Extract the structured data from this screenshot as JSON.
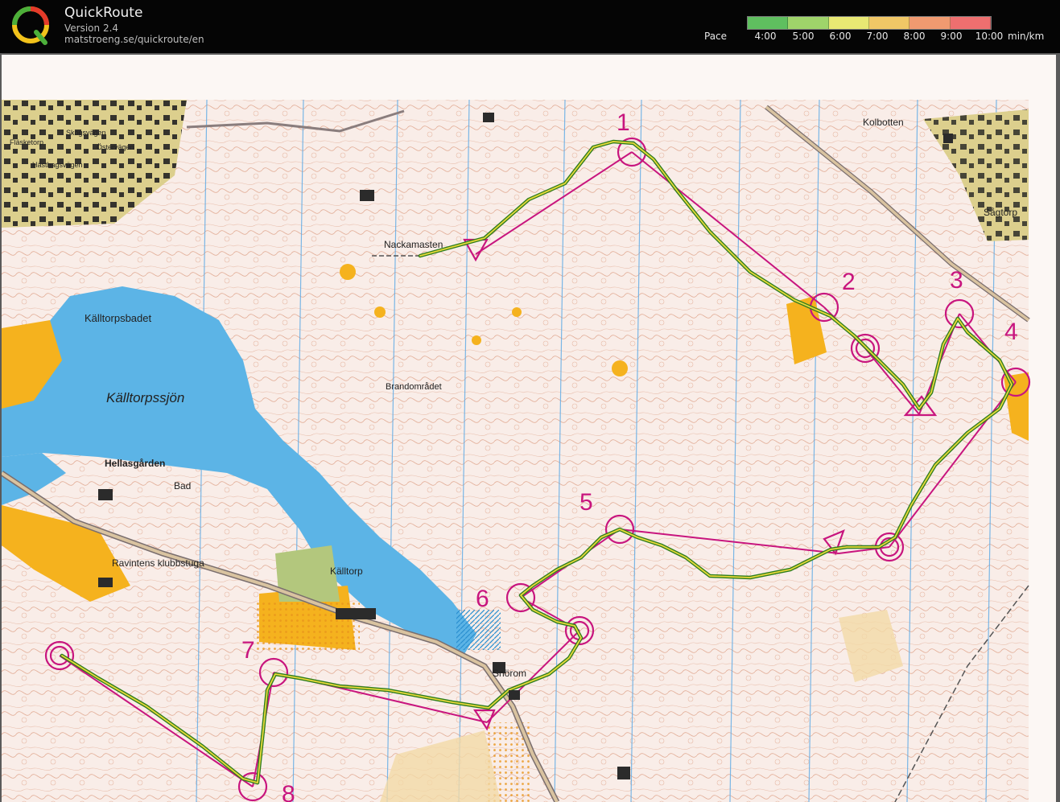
{
  "app": {
    "title": "QuickRoute",
    "version": "Version 2.4",
    "url": "matstroeng.se/quickroute/en",
    "logo_letter": "Q"
  },
  "pace_legend": {
    "label": "Pace",
    "ticks": [
      "4:00",
      "5:00",
      "6:00",
      "7:00",
      "8:00",
      "9:00",
      "10:00"
    ],
    "unit": "min/km",
    "colors": [
      "#5fbf5f",
      "#9fd46a",
      "#e8e873",
      "#f0c766",
      "#f09a70",
      "#ee6f6f"
    ]
  },
  "map": {
    "colors": {
      "course": "#c8157e",
      "water": "#5cb4e6",
      "contour": "#c8663e",
      "open_land": "#f5b21e",
      "route": "#2e7d1e",
      "route_core": "#e8d83a"
    },
    "place_names": [
      "Källtorpsbadet",
      "Källtorpssjön",
      "Hellasgården",
      "Bad",
      "Ravintens klubbstuga",
      "Källtorp",
      "Nackamasten",
      "Brandområdet",
      "Kolbotten",
      "Sågtorp",
      "Snörom",
      "Skogsvägen",
      "Östervägen",
      "Fläsketorp",
      "Hästhagsvägen"
    ],
    "controls": [
      "1",
      "2",
      "3",
      "4",
      "5",
      "6",
      "7",
      "8"
    ]
  }
}
